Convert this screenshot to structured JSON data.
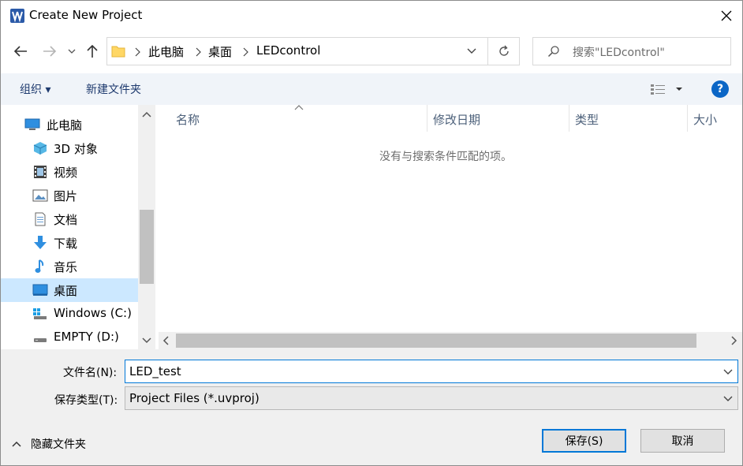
{
  "window": {
    "title": "Create New Project",
    "close_glyph": "✕"
  },
  "nav": {
    "breadcrumbs": [
      "此电脑",
      "桌面",
      "LEDcontrol"
    ],
    "search_placeholder": "搜索\"LEDcontrol\""
  },
  "toolbar": {
    "organize": "组织 ▾",
    "new_folder": "新建文件夹",
    "help": "?"
  },
  "navpane": {
    "items": [
      {
        "label": "此电脑",
        "icon": "computer-icon"
      },
      {
        "label": "3D 对象",
        "icon": "3d-objects-icon"
      },
      {
        "label": "视频",
        "icon": "video-icon"
      },
      {
        "label": "图片",
        "icon": "pictures-icon"
      },
      {
        "label": "文档",
        "icon": "documents-icon"
      },
      {
        "label": "下载",
        "icon": "download-icon"
      },
      {
        "label": "音乐",
        "icon": "music-icon"
      },
      {
        "label": "桌面",
        "icon": "desktop-icon",
        "selected": true
      },
      {
        "label": "Windows  (C:)",
        "icon": "drive-icon"
      },
      {
        "label": "EMPTY (D:)",
        "icon": "drive-icon"
      }
    ]
  },
  "filelist": {
    "columns": [
      "名称",
      "修改日期",
      "类型",
      "大小"
    ],
    "empty_message": "没有与搜索条件匹配的项。"
  },
  "form": {
    "filename_label": "文件名(N):",
    "filename_value": "LED_test",
    "filetype_label": "保存类型(T):",
    "filetype_value": "Project Files (*.uvproj)"
  },
  "footer": {
    "hide_folders": "隐藏文件夹",
    "save": "保存(S)",
    "cancel": "取消"
  },
  "colors": {
    "accent": "#0078d7",
    "selection": "#cce8ff",
    "toolbar_bg": "#f0f4f9"
  }
}
